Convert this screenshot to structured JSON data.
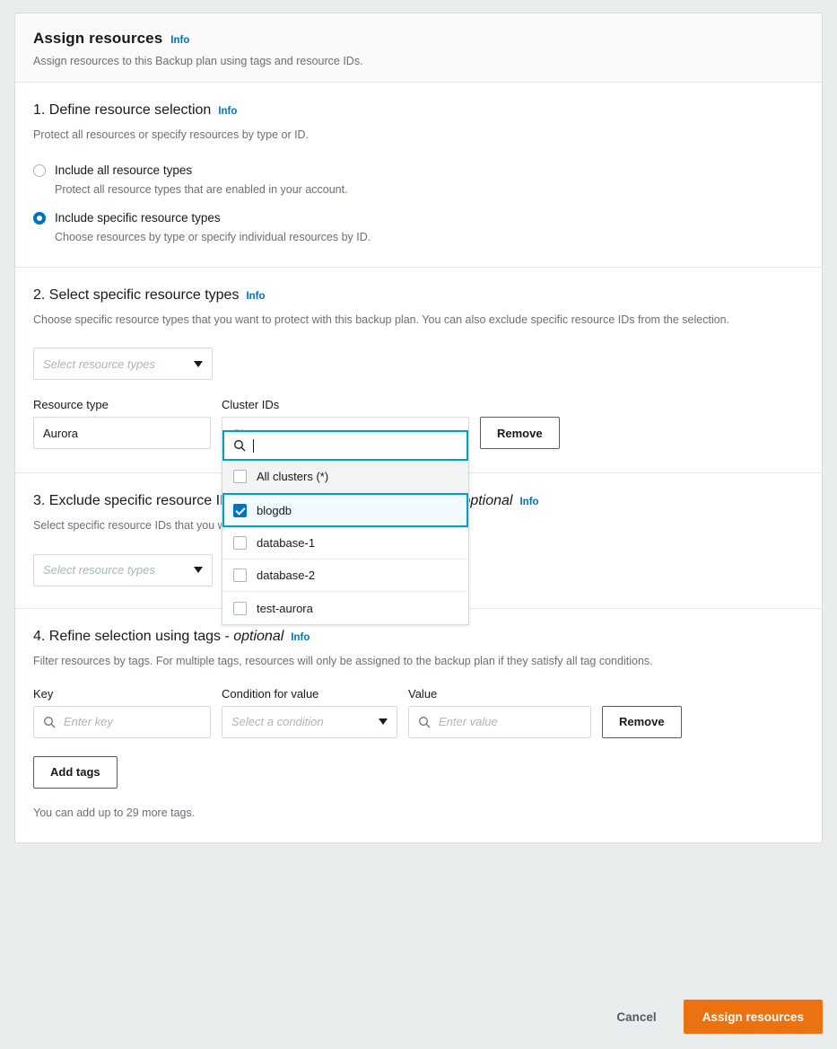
{
  "card": {
    "title": "Assign resources",
    "info_label": "Info",
    "subtitle": "Assign resources to this Backup plan using tags and resource IDs."
  },
  "section1": {
    "title": "1. Define resource selection",
    "info_label": "Info",
    "description": "Protect all resources or specify resources by type or ID.",
    "options": [
      {
        "label": "Include all resource types",
        "sublabel": "Protect all resource types that are enabled in your account.",
        "selected": false
      },
      {
        "label": "Include specific resource types",
        "sublabel": "Choose resources by type or specify individual resources by ID.",
        "selected": true
      }
    ]
  },
  "section2": {
    "title": "2. Select specific resource types",
    "info_label": "Info",
    "description": "Choose specific resource types that you want to protect with this backup plan. You can also exclude specific resource IDs from the selection.",
    "select_placeholder": "Select resource types",
    "resource_type_label": "Resource type",
    "resource_type_value": "Aurora",
    "cluster_ids_label": "Cluster IDs",
    "cluster_ids_placeholder": "Choose resources",
    "remove_label": "Remove",
    "dropdown": {
      "search_value": "",
      "options": [
        {
          "label": "All clusters (*)",
          "checked": false,
          "hovered": true,
          "selected": false
        },
        {
          "label": "blogdb",
          "checked": true,
          "hovered": false,
          "selected": true
        },
        {
          "label": "database-1",
          "checked": false,
          "hovered": false,
          "selected": false
        },
        {
          "label": "database-2",
          "checked": false,
          "hovered": false,
          "selected": false
        },
        {
          "label": "test-aurora",
          "checked": false,
          "hovered": false,
          "selected": false
        }
      ]
    }
  },
  "section3": {
    "title": "3. Exclude specific resource IDs from the selected resource types - ",
    "title_optional": "optional",
    "info_label": "Info",
    "description": "Select specific resource IDs that you want to exclude from the backup plan.",
    "select_placeholder": "Select resource types"
  },
  "section4": {
    "title": "4. Refine selection using tags - ",
    "title_optional": "optional",
    "info_label": "Info",
    "description": "Filter resources by tags. For multiple tags, resources will only be assigned to the backup plan if they satisfy all tag conditions.",
    "key_label": "Key",
    "key_placeholder": "Enter key",
    "condition_label": "Condition for value",
    "condition_placeholder": "Select a condition",
    "value_label": "Value",
    "value_placeholder": "Enter value",
    "remove_label": "Remove",
    "add_tags_label": "Add tags",
    "help_text": "You can add up to 29 more tags."
  },
  "footer": {
    "cancel_label": "Cancel",
    "submit_label": "Assign resources"
  },
  "colors": {
    "accent_blue": "#0073BB",
    "focus_cyan": "#00A1C9",
    "primary_orange": "#EC7211",
    "selected_row_bg": "#F1FAFF",
    "page_bg": "#EAEDED"
  }
}
